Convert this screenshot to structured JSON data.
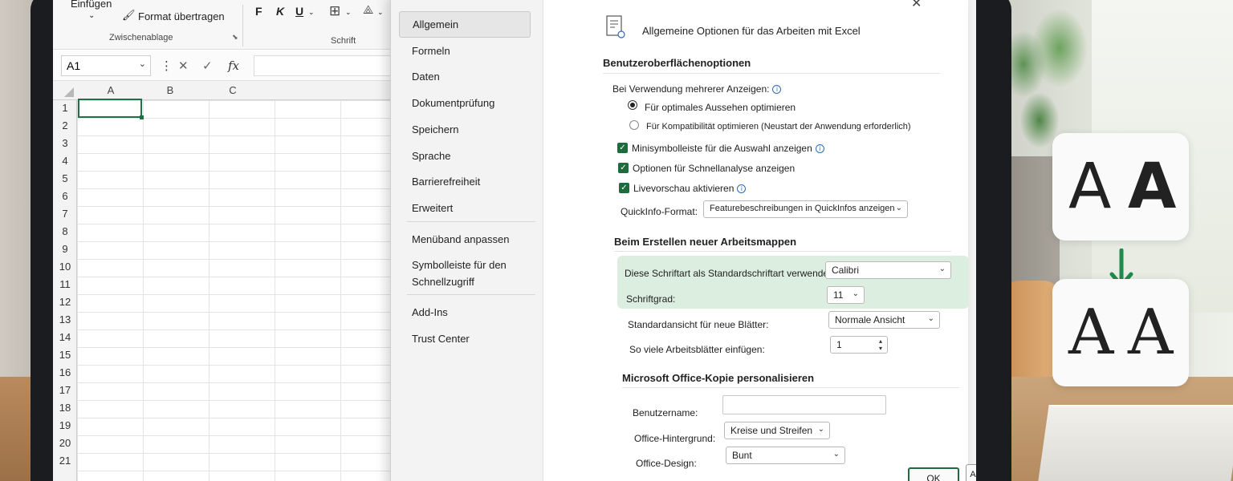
{
  "ribbon": {
    "einfuegen": "Einfügen",
    "format_uebertragen": "Format übertragen",
    "zwischenablage": "Zwischenablage",
    "schrift": "Schrift",
    "bold": "F",
    "italic": "K",
    "underline": "U"
  },
  "formula_bar": {
    "name_box": "A1",
    "fx": "fx"
  },
  "grid": {
    "columns": [
      "A",
      "B",
      "C"
    ],
    "rows": [
      "1",
      "2",
      "3",
      "4",
      "5",
      "6",
      "7",
      "8",
      "9",
      "10",
      "11",
      "12",
      "13",
      "14",
      "15",
      "16",
      "17",
      "18",
      "19",
      "20",
      "21"
    ]
  },
  "dialog": {
    "nav": [
      "Allgemein",
      "Formeln",
      "Daten",
      "Dokumentprüfung",
      "Speichern",
      "Sprache",
      "Barrierefreiheit",
      "Erweitert",
      "Menüband anpassen",
      "Symbolleiste für den Schnellzugriff",
      "Add-Ins",
      "Trust Center"
    ],
    "header": "Allgemeine Optionen für das Arbeiten mit Excel",
    "sections": {
      "ui": "Benutzeroberflächenoptionen",
      "new_workbooks": "Beim Erstellen neuer Arbeitsmappen",
      "personalize": "Microsoft Office-Kopie personalisieren"
    },
    "multi_display_label": "Bei Verwendung mehrerer Anzeigen:",
    "radio_optimal": "Für optimales Aussehen optimieren",
    "radio_compat": "Für Kompatibilität optimieren (Neustart der Anwendung erforderlich)",
    "chk_minitoolbar": "Minisymbolleiste für die Auswahl anzeigen",
    "chk_quickanalysis": "Optionen für Schnellanalyse anzeigen",
    "chk_livepreview": "Livevorschau aktivieren",
    "quickinfo_label": "QuickInfo-Format:",
    "quickinfo_value": "Featurebeschreibungen in QuickInfos anzeigen",
    "default_font_label": "Diese Schriftart als Standardschriftart verwenden:",
    "default_font_value": "Calibri",
    "font_size_label": "Schriftgrad:",
    "font_size_value": "11",
    "default_view_label": "Standardansicht für neue Blätter:",
    "default_view_value": "Normale Ansicht",
    "sheet_count_label": "So viele Arbeitsblätter einfügen:",
    "sheet_count_value": "1",
    "username_label": "Benutzername:",
    "username_value": "",
    "office_bg_label": "Office-Hintergrund:",
    "office_bg_value": "Kreise und Streifen",
    "office_design_label": "Office-Design:",
    "office_design_value": "Bunt",
    "ok": "OK",
    "cancel": "Abbrechen"
  },
  "badges": {
    "top_left": "A",
    "top_right": "A",
    "bottom_left": "A",
    "bottom_right": "A",
    "arrow_color": "#1e8a4c"
  }
}
